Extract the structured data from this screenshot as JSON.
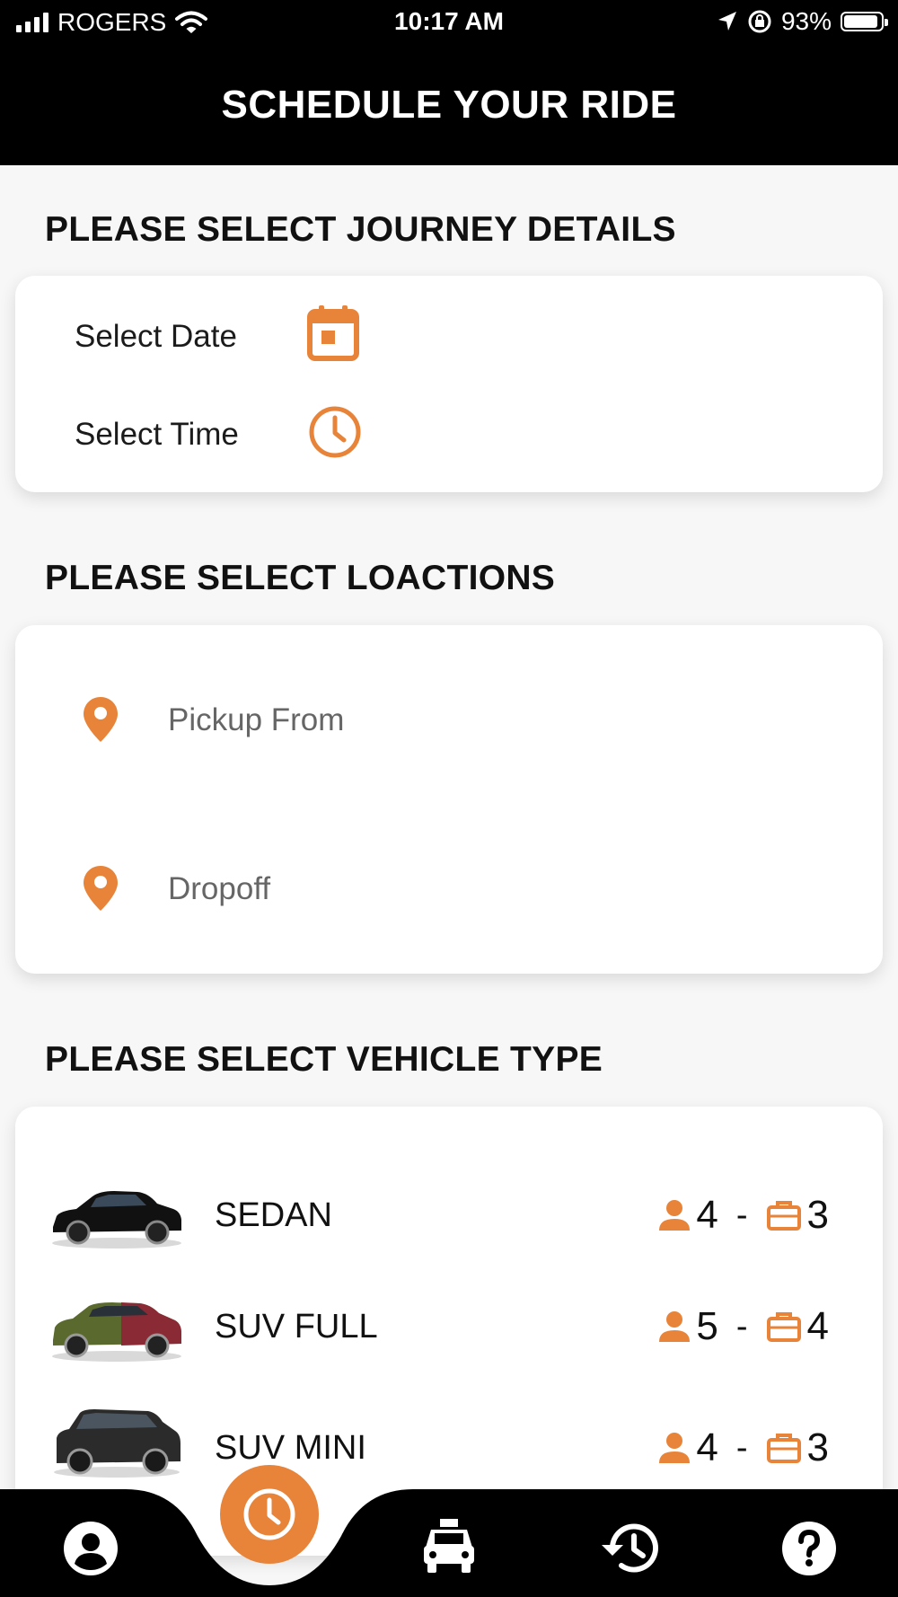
{
  "status_bar": {
    "carrier": "ROGERS",
    "time": "10:17 AM",
    "battery": "93%",
    "battery_level": 0.93
  },
  "header": {
    "title": "SCHEDULE YOUR RIDE"
  },
  "journey": {
    "section_title": "PLEASE SELECT JOURNEY DETAILS",
    "date_label": "Select Date",
    "time_label": "Select Time"
  },
  "locations": {
    "section_title": "PLEASE SELECT LOACTIONS",
    "pickup_placeholder": "Pickup From",
    "dropoff_placeholder": "Dropoff"
  },
  "vehicles": {
    "section_title": "PLEASE SELECT VEHICLE TYPE",
    "items": [
      {
        "name": "SEDAN",
        "passengers": "4",
        "separator": "-",
        "luggage": "3",
        "color": "#111111"
      },
      {
        "name": "SUV FULL",
        "passengers": "5",
        "separator": "-",
        "luggage": "4",
        "color": "#7a2a2e"
      },
      {
        "name": "SUV MINI",
        "passengers": "4",
        "separator": "-",
        "luggage": "3",
        "color": "#2b2b2b"
      }
    ]
  },
  "bottom_nav": {
    "items": [
      "profile-icon",
      "clock-icon",
      "taxi-icon",
      "history-icon",
      "help-icon"
    ],
    "active": "clock-icon"
  },
  "colors": {
    "accent": "#E8843A",
    "bar": "#000000",
    "background": "#F7F7F7"
  }
}
